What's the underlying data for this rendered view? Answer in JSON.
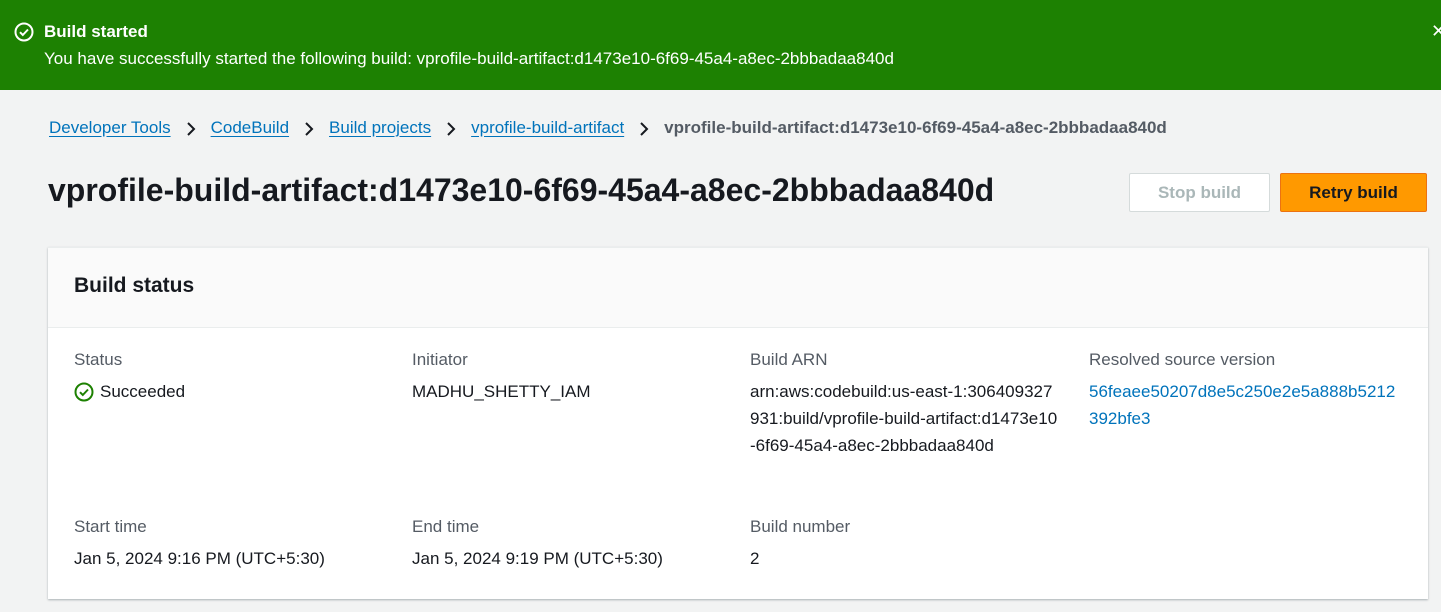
{
  "flash": {
    "title": "Build started",
    "message": "You have successfully started the following build: vprofile-build-artifact:d1473e10-6f69-45a4-a8ec-2bbbadaa840d",
    "dismiss_icon": "close-icon",
    "status_icon": "check-circle-icon",
    "color": "#1d8102"
  },
  "breadcrumb": {
    "items": [
      "Developer Tools",
      "CodeBuild",
      "Build projects",
      "vprofile-build-artifact"
    ],
    "current": "vprofile-build-artifact:d1473e10-6f69-45a4-a8ec-2bbbadaa840d"
  },
  "page": {
    "title": "vprofile-build-artifact:d1473e10-6f69-45a4-a8ec-2bbbadaa840d"
  },
  "actions": {
    "stop_label": "Stop build",
    "retry_label": "Retry build",
    "accent_color": "#ff9900"
  },
  "build_status": {
    "heading": "Build status",
    "status_label": "Status",
    "status_value": "Succeeded",
    "initiator_label": "Initiator",
    "initiator_value": "MADHU_SHETTY_IAM",
    "arn_label": "Build ARN",
    "arn_value": "arn:aws:codebuild:us-east-1:306409327931:build/vprofile-build-artifact:d1473e10-6f69-45a4-a8ec-2bbbadaa840d",
    "source_label": "Resolved source version",
    "source_value": "56feaee50207d8e5c250e2e5a888b5212392bfe3",
    "start_label": "Start time",
    "start_value": "Jan 5, 2024 9:16 PM (UTC+5:30)",
    "end_label": "End time",
    "end_value": "Jan 5, 2024 9:19 PM (UTC+5:30)",
    "number_label": "Build number",
    "number_value": "2"
  }
}
